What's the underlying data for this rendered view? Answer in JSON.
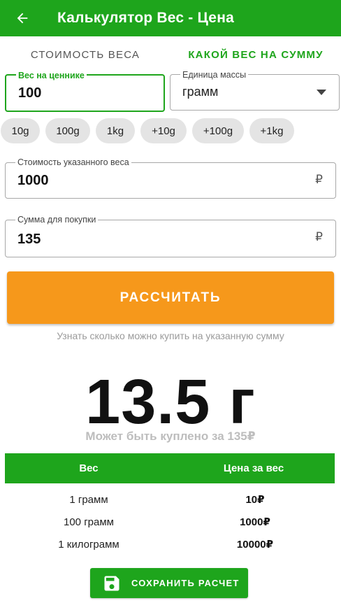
{
  "appbar": {
    "title": "Калькулятор Вес - Цена",
    "back_icon": "arrow-left-icon"
  },
  "tabs": [
    {
      "label": "СТОИМОСТЬ ВЕСА",
      "active": false
    },
    {
      "label": "КАКОЙ ВЕС НА СУММУ",
      "active": true
    }
  ],
  "weight_field": {
    "label": "Вес на ценнике",
    "value": "100"
  },
  "unit_field": {
    "label": "Единица массы",
    "value": "грамм"
  },
  "chips": [
    "10g",
    "100g",
    "1kg",
    "+10g",
    "+100g",
    "+1kg"
  ],
  "price_field": {
    "label": "Стоимость указанного веса",
    "value": "1000",
    "suffix": "₽"
  },
  "sum_field": {
    "label": "Сумма для покупки",
    "value": "135",
    "suffix": "₽"
  },
  "calculate": {
    "label": "РАССЧИТАТЬ",
    "hint": "Узнать сколько можно купить на указанную сумму"
  },
  "result": {
    "value": "13.5 г",
    "subtitle": "Может быть куплено за 135₽"
  },
  "table": {
    "headers": [
      "Вес",
      "Цена за вес"
    ],
    "rows": [
      {
        "weight": "1 грамм",
        "price": "10₽"
      },
      {
        "weight": "100 грамм",
        "price": "1000₽"
      },
      {
        "weight": "1 килограмм",
        "price": "10000₽"
      }
    ]
  },
  "save": {
    "label": "СОХРАНИТЬ РАСЧЕТ",
    "icon": "floppy-disk-icon"
  },
  "colors": {
    "primary": "#1ea51c",
    "accent": "#f6981b"
  }
}
